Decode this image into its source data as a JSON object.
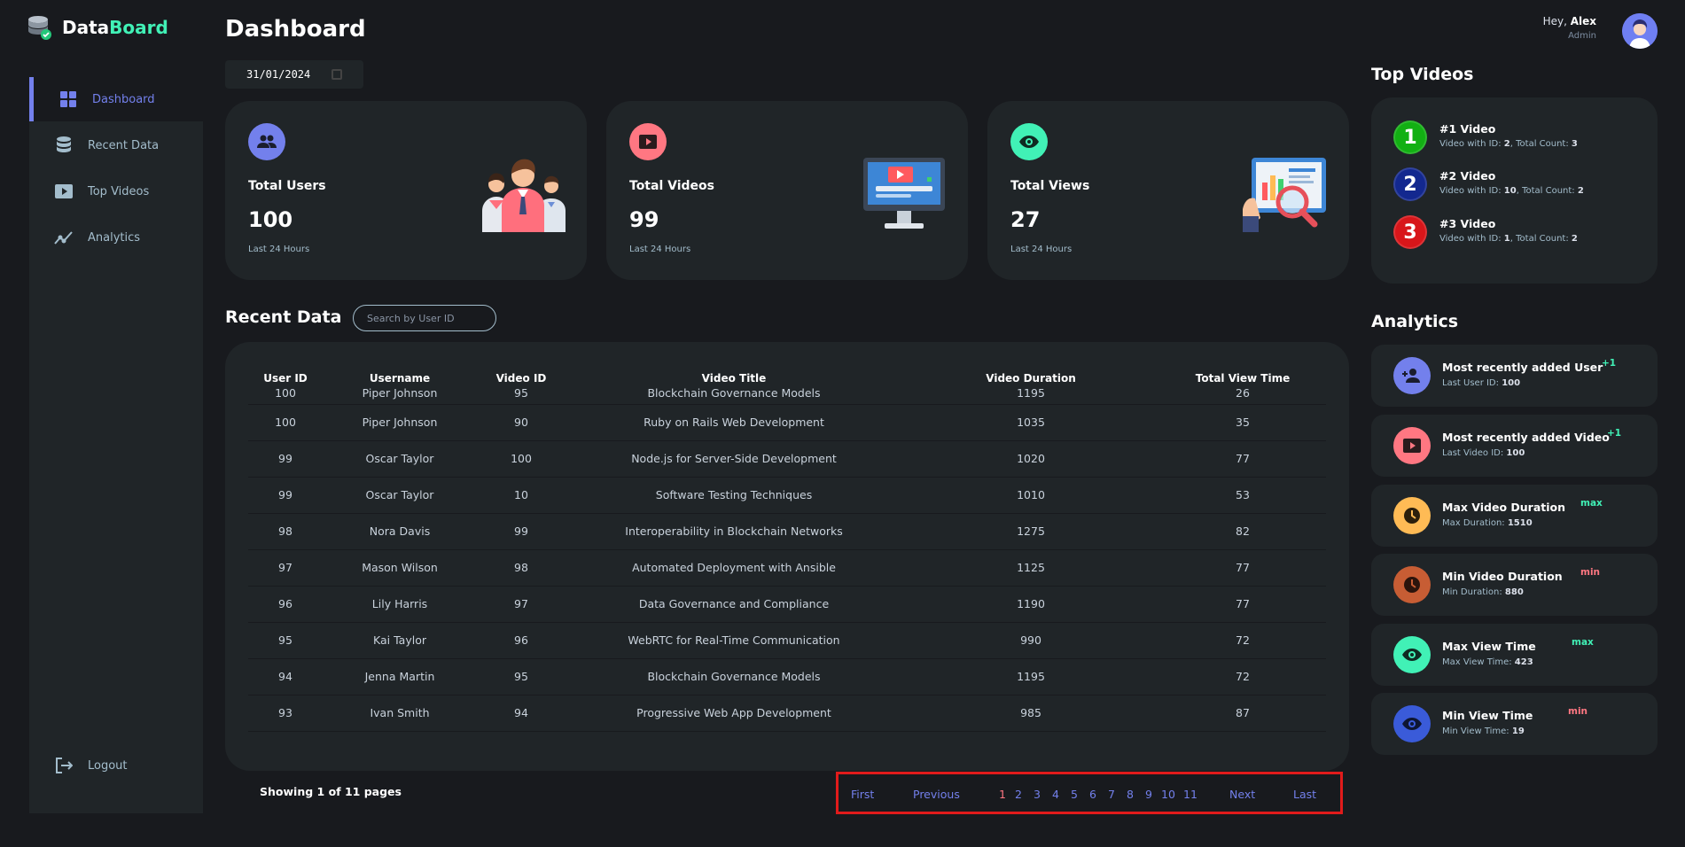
{
  "brand": {
    "prefix": "Data",
    "accent": "Board"
  },
  "sidebar": {
    "items": [
      {
        "label": "Dashboard",
        "icon": "grid-icon",
        "active": true
      },
      {
        "label": "Recent Data",
        "icon": "database-icon"
      },
      {
        "label": "Top Videos",
        "icon": "video-play-icon"
      },
      {
        "label": "Analytics",
        "icon": "chart-line-icon"
      }
    ],
    "logout": "Logout"
  },
  "header": {
    "title": "Dashboard",
    "date": "31/01/2024",
    "greeting": "Hey, ",
    "user_name": "Alex",
    "role": "Admin"
  },
  "cards": [
    {
      "label": "Total Users",
      "value": "100",
      "sub": "Last 24 Hours",
      "color": "#7380ec"
    },
    {
      "label": "Total Videos",
      "value": "99",
      "sub": "Last 24 Hours",
      "color": "#ff7782"
    },
    {
      "label": "Total Views",
      "value": "27",
      "sub": "Last 24 Hours",
      "color": "#41f1b6"
    }
  ],
  "recent": {
    "title": "Recent Data",
    "search_placeholder": "Search by User ID",
    "columns": [
      "User ID",
      "Username",
      "Video ID",
      "Video Title",
      "Video Duration",
      "Total View Time"
    ],
    "rows": [
      [
        "100",
        "Piper Johnson",
        "95",
        "Blockchain Governance Models",
        "1195",
        "26"
      ],
      [
        "100",
        "Piper Johnson",
        "90",
        "Ruby on Rails Web Development",
        "1035",
        "35"
      ],
      [
        "99",
        "Oscar Taylor",
        "100",
        "Node.js for Server-Side Development",
        "1020",
        "77"
      ],
      [
        "99",
        "Oscar Taylor",
        "10",
        "Software Testing Techniques",
        "1010",
        "53"
      ],
      [
        "98",
        "Nora Davis",
        "99",
        "Interoperability in Blockchain Networks",
        "1275",
        "82"
      ],
      [
        "97",
        "Mason Wilson",
        "98",
        "Automated Deployment with Ansible",
        "1125",
        "77"
      ],
      [
        "96",
        "Lily Harris",
        "97",
        "Data Governance and Compliance",
        "1190",
        "77"
      ],
      [
        "95",
        "Kai Taylor",
        "96",
        "WebRTC for Real-Time Communication",
        "990",
        "72"
      ],
      [
        "94",
        "Jenna Martin",
        "95",
        "Blockchain Governance Models",
        "1195",
        "72"
      ],
      [
        "93",
        "Ivan Smith",
        "94",
        "Progressive Web App Development",
        "985",
        "87"
      ]
    ],
    "showing": "Showing 1 of 11 pages"
  },
  "pagination": {
    "first": "First",
    "previous": "Previous",
    "pages": [
      "1",
      "2",
      "3",
      "4",
      "5",
      "6",
      "7",
      "8",
      "9",
      "10",
      "11"
    ],
    "current": "1",
    "next": "Next",
    "last": "Last"
  },
  "top_videos": {
    "title": "Top Videos",
    "items": [
      {
        "rank": "1",
        "title": "#1 Video",
        "id_label": "Video with ID: ",
        "id": "2",
        "count_label": ", Total Count: ",
        "count": "3",
        "color": "#12b013"
      },
      {
        "rank": "2",
        "title": "#2 Video",
        "id_label": "Video with ID: ",
        "id": "10",
        "count_label": ", Total Count: ",
        "count": "2",
        "color": "#13288f"
      },
      {
        "rank": "3",
        "title": "#3 Video",
        "id_label": "Video with ID: ",
        "id": "1",
        "count_label": ", Total Count: ",
        "count": "2",
        "color": "#d8161a"
      }
    ]
  },
  "analytics": {
    "title": "Analytics",
    "items": [
      {
        "title": "Most recently added User",
        "desc_label": "Last User ID: ",
        "desc_value": "100",
        "tag": "+1",
        "tag_color": "#41f1b6",
        "color": "#7380ec",
        "icon": "user-add-icon"
      },
      {
        "title": "Most recently added Video",
        "desc_label": "Last Video ID: ",
        "desc_value": "100",
        "tag": "+1",
        "tag_color": "#41f1b6",
        "color": "#ff7782",
        "icon": "video-play-icon"
      },
      {
        "title": "Max Video Duration",
        "desc_label": "Max Duration: ",
        "desc_value": "1510",
        "tag": "max",
        "tag_color": "#41f1b6",
        "color": "#ffbb55",
        "icon": "clock-icon"
      },
      {
        "title": "Min Video Duration",
        "desc_label": "Min Duration: ",
        "desc_value": "880",
        "tag": "min",
        "tag_color": "#ff7782",
        "color": "#c75d34",
        "icon": "clock-icon"
      },
      {
        "title": "Max View Time",
        "desc_label": "Max View Time: ",
        "desc_value": "423",
        "tag": "max",
        "tag_color": "#41f1b6",
        "color": "#41f1b6",
        "icon": "eye-icon"
      },
      {
        "title": "Min View Time",
        "desc_label": "Min View Time: ",
        "desc_value": "19",
        "tag": "min",
        "tag_color": "#ff7782",
        "color": "#3a5bd9",
        "icon": "eye-icon"
      }
    ]
  }
}
